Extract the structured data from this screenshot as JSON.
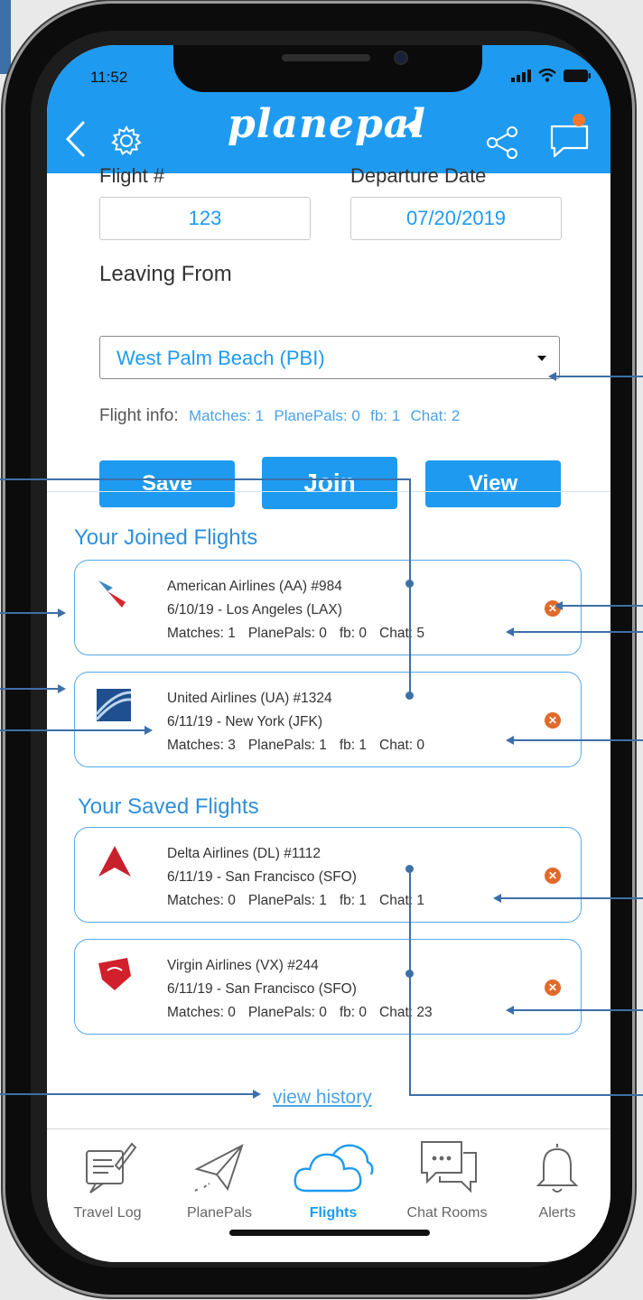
{
  "status": {
    "time": "11:52"
  },
  "header": {
    "brand": "planepal"
  },
  "form": {
    "flight_label": "Flight #",
    "flight_value": "123",
    "date_label": "Departure Date",
    "date_value": "07/20/2019",
    "leaving_label": "Leaving From",
    "leaving_value": "West Palm Beach (PBI)",
    "info_label": "Flight info:",
    "info": [
      "Matches: 1",
      "PlanePals: 0",
      "fb: 1",
      "Chat: 2"
    ],
    "save_label": "Save",
    "join_label": "Join",
    "view_label": "View"
  },
  "joined": {
    "title": "Your Joined Flights",
    "items": [
      {
        "airline": "American Airlines (AA) #984",
        "date_dest": "6/10/19  -  Los Angeles (LAX)",
        "matches": "Matches: 1",
        "planepals": "PlanePals: 0",
        "fb": "fb: 0",
        "chat": "Chat: 5"
      },
      {
        "airline": "United Airlines (UA) #1324",
        "date_dest": "6/11/19  -  New York (JFK)",
        "matches": "Matches: 3",
        "planepals": "PlanePals: 1",
        "fb": "fb: 1",
        "chat": "Chat: 0"
      }
    ]
  },
  "saved": {
    "title": "Your Saved Flights",
    "items": [
      {
        "airline": "Delta Airlines (DL) #1112",
        "date_dest": "6/11/19  -  San Francisco (SFO)",
        "matches": "Matches: 0",
        "planepals": "PlanePals: 1",
        "fb": "fb: 1",
        "chat": "Chat: 1"
      },
      {
        "airline": "Virgin Airlines (VX) #244",
        "date_dest": "6/11/19  -  San Francisco (SFO)",
        "matches": "Matches: 0",
        "planepals": "PlanePals: 0",
        "fb": "fb: 0",
        "chat": "Chat: 23"
      }
    ]
  },
  "history_link": "view history",
  "tabs": [
    {
      "label": "Travel Log",
      "icon": "notepad-icon"
    },
    {
      "label": "PlanePals",
      "icon": "paper-plane-icon"
    },
    {
      "label": "Flights",
      "icon": "cloud-icon",
      "active": true
    },
    {
      "label": "Chat Rooms",
      "icon": "chat-bubbles-icon"
    },
    {
      "label": "Alerts",
      "icon": "bell-icon"
    }
  ],
  "colors": {
    "accent": "#1e9bf0",
    "remove": "#e06a2a",
    "notification": "#f7772c",
    "annotation": "#3d6fa8"
  }
}
